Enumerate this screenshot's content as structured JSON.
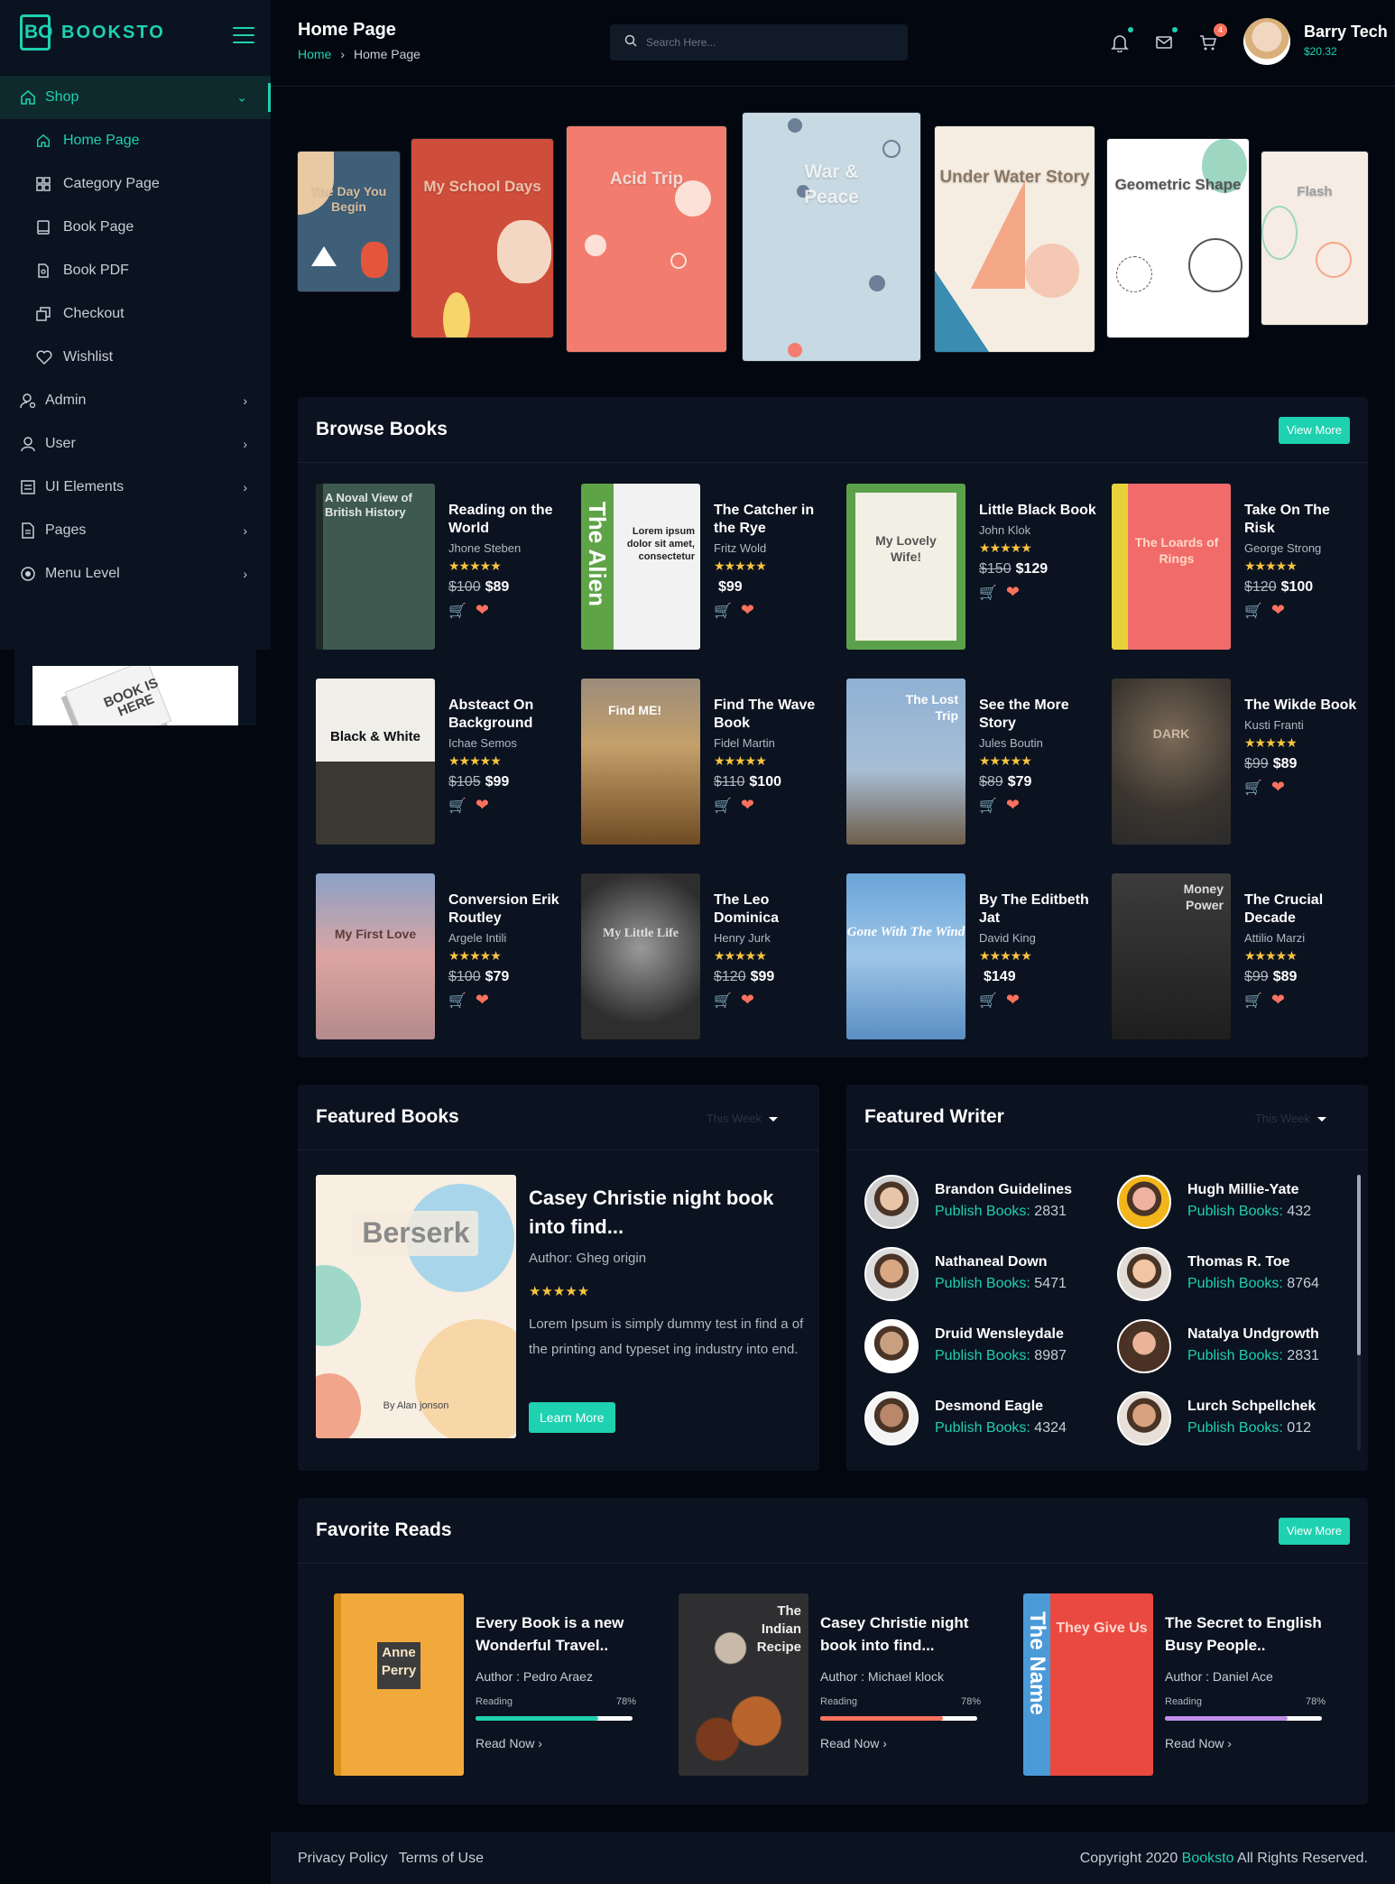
{
  "brand": {
    "name": "BOOKSTO",
    "mark": "BO"
  },
  "sidebar": {
    "shop": "Shop",
    "sub": [
      "Home Page",
      "Category Page",
      "Book Page",
      "Book PDF",
      "Checkout",
      "Wishlist"
    ],
    "items": [
      "Admin",
      "User",
      "UI Elements",
      "Pages",
      "Menu Level"
    ],
    "ad_text": "BOOK IS HERE"
  },
  "header": {
    "title": "Home Page",
    "crumb_home": "Home",
    "crumb_current": "Home Page",
    "search_placeholder": "Search Here...",
    "cart_badge": "4",
    "user_name": "Barry Tech",
    "user_balance": "$20.32"
  },
  "carousel": [
    {
      "title": "The Day You Begin"
    },
    {
      "title": "My School Days"
    },
    {
      "title": "Acid Trip"
    },
    {
      "title": "War & Peace"
    },
    {
      "title": "Under Water Story"
    },
    {
      "title": "Geometric Shape"
    },
    {
      "title": "Flash"
    }
  ],
  "browse": {
    "title": "Browse Books",
    "view_more": "View More",
    "books": [
      {
        "cover": "A Noval View of British History",
        "title": "Reading on the World",
        "author": "Jhone Steben",
        "old": "$100",
        "price": "$89"
      },
      {
        "cover": "The Alien",
        "title": "The Catcher in the Rye",
        "author": "Fritz Wold",
        "old": "",
        "price": "$99"
      },
      {
        "cover": "My Lovely Wife!",
        "title": "Little Black Book",
        "author": "John Klok",
        "old": "$150",
        "price": "$129"
      },
      {
        "cover": "The Loards of Rings",
        "title": "Take On The Risk",
        "author": "George Strong",
        "old": "$120",
        "price": "$100"
      },
      {
        "cover": "Black & White",
        "title": "Absteact On Background",
        "author": "Ichae Semos",
        "old": "$105",
        "price": "$99"
      },
      {
        "cover": "Find ME!",
        "title": "Find The Wave Book",
        "author": "Fidel Martin",
        "old": "$110",
        "price": "$100"
      },
      {
        "cover": "The Lost Trip",
        "title": "See the More Story",
        "author": "Jules Boutin",
        "old": "$89",
        "price": "$79"
      },
      {
        "cover": "DARK",
        "title": "The Wikde Book",
        "author": "Kusti Franti",
        "old": "$99",
        "price": "$89"
      },
      {
        "cover": "My First Love",
        "title": "Conversion Erik Routley",
        "author": "Argele Intili",
        "old": "$100",
        "price": "$79"
      },
      {
        "cover": "My Little Life",
        "title": "The Leo Dominica",
        "author": "Henry Jurk",
        "old": "$120",
        "price": "$99"
      },
      {
        "cover": "Gone With The Wind",
        "title": "By The Editbeth Jat",
        "author": "David King",
        "old": "",
        "price": "$149"
      },
      {
        "cover": "Money Power",
        "title": "The Crucial Decade",
        "author": "Attilio Marzi",
        "old": "$99",
        "price": "$89"
      }
    ]
  },
  "featured_books": {
    "title": "Featured Books",
    "filter": "This Week",
    "cover_title": "Berserk",
    "cover_author": "By Alan jonson",
    "book_title": "Casey Christie night book into find...",
    "author": "Author: Gheg origin",
    "desc": "Lorem Ipsum is simply dummy test in find a of the printing and typeset ing industry into end.",
    "button": "Learn More"
  },
  "featured_writer": {
    "title": "Featured Writer",
    "filter": "This Week",
    "label": "Publish Books:",
    "writers": [
      {
        "name": "Brandon Guidelines",
        "count": "2831"
      },
      {
        "name": "Hugh Millie-Yate",
        "count": "432"
      },
      {
        "name": "Nathaneal Down",
        "count": "5471"
      },
      {
        "name": "Thomas R. Toe",
        "count": "8764"
      },
      {
        "name": "Druid Wensleydale",
        "count": "8987"
      },
      {
        "name": "Natalya Undgrowth",
        "count": "2831"
      },
      {
        "name": "Desmond Eagle",
        "count": "4324"
      },
      {
        "name": "Lurch Schpellchek",
        "count": "012"
      }
    ]
  },
  "favorites": {
    "title": "Favorite Reads",
    "view_more": "View More",
    "reading_label": "Reading",
    "read_now": "Read Now ›",
    "items": [
      {
        "cover": "Anne Perry",
        "title": "Every Book is a new Wonderful Travel..",
        "author": "Author : Pedro Araez",
        "pct": "78%",
        "progress": 0.78,
        "color": "#1ed1b0"
      },
      {
        "cover": "The Indian Recipe",
        "title": "Casey Christie night book into find...",
        "author": "Author : Michael klock",
        "pct": "78%",
        "progress": 0.78,
        "color": "#f9715d"
      },
      {
        "cover": "They Give Us",
        "spine": "The Name",
        "title": "The Secret to English Busy People..",
        "author": "Author : Daniel Ace",
        "pct": "78%",
        "progress": 0.78,
        "color": "#c08ee9"
      }
    ]
  },
  "footer": {
    "privacy": "Privacy Policy",
    "terms": "Terms of Use",
    "copy_pre": "Copyright 2020",
    "copy_brand": "Booksto",
    "copy_post": "All Rights Reserved."
  }
}
